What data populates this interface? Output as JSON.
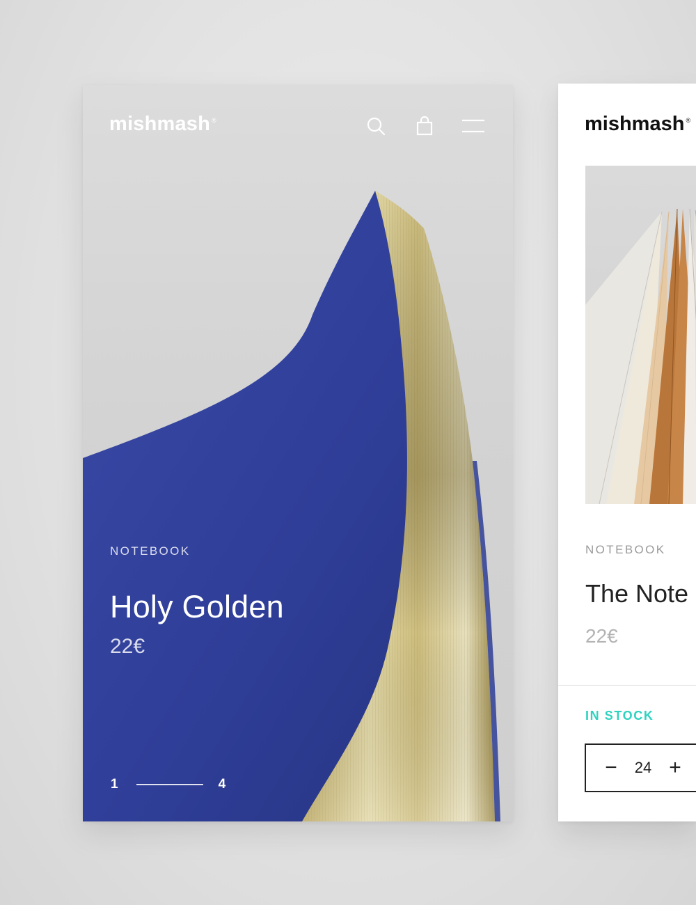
{
  "hero_card": {
    "brand": "mishmash",
    "brand_mark": "®",
    "header_icons": [
      "search-icon",
      "bag-icon",
      "menu-icon"
    ],
    "category": "NOTEBOOK",
    "title": "Holy Golden",
    "price": "22€",
    "pager": {
      "current": "1",
      "total": "4"
    },
    "colors": {
      "cover": "#2f3f9b",
      "pages": "#c9b877",
      "background": "#d6d6d6"
    }
  },
  "detail_card": {
    "brand": "mishmash",
    "brand_mark": "®",
    "category": "NOTEBOOK",
    "title": "The Note",
    "price": "22€",
    "stock_status": "IN STOCK",
    "quantity": "24",
    "stepper_minus": "−",
    "stepper_plus": "+",
    "colors": {
      "stock": "#2ed3c0",
      "text": "#222222",
      "muted": "#b3b3b3"
    }
  }
}
